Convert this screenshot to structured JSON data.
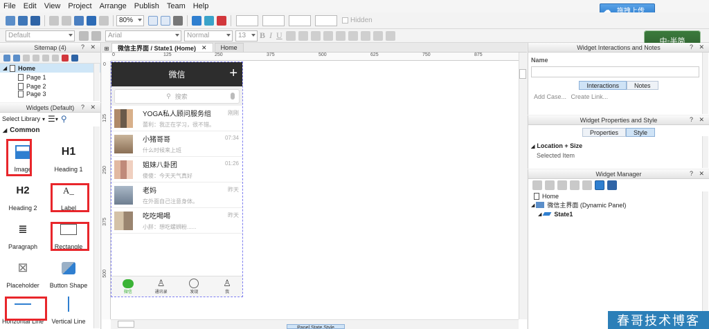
{
  "menu": [
    "File",
    "Edit",
    "View",
    "Project",
    "Arrange",
    "Publish",
    "Team",
    "Help"
  ],
  "upload_label": "拖拽上传",
  "toolbar": {
    "zoom": "80%",
    "hidden_label": "Hidden"
  },
  "format_bar": {
    "style": "Default",
    "font": "Arial",
    "weight": "Normal",
    "size": "13"
  },
  "logo_text": "中◦半简",
  "sitemap": {
    "title": "Sitemap (4)",
    "root": "Home",
    "pages": [
      "Page 1",
      "Page 2",
      "Page 3"
    ]
  },
  "widgets": {
    "title": "Widgets (Default)",
    "select_library": "Select Library",
    "category": "Common",
    "items": [
      "Image",
      "Heading 1",
      "Heading 2",
      "Label",
      "Paragraph",
      "Rectangle",
      "Placeholder",
      "Button Shape",
      "Horizontal Line",
      "Vertical Line"
    ],
    "glyph_h1": "H1",
    "glyph_h2": "H2",
    "glyph_label": "A_"
  },
  "canvas": {
    "tab_active": "微信主界面 / State1 (Home)",
    "tab_other": "Home",
    "ruler_h": [
      "0",
      "125",
      "250",
      "375",
      "500",
      "625",
      "750",
      "875"
    ],
    "ruler_v": [
      "0",
      "125",
      "250",
      "375",
      "500"
    ],
    "panel_state_style": "Panel State Style"
  },
  "phone": {
    "title": "微信",
    "plus": "+",
    "search": "搜索",
    "chats": [
      {
        "name": "YOGA私人顾问服务组",
        "msg": "蕾利：我正在学习，很不错。",
        "time": "刚刚"
      },
      {
        "name": "小猪哥哥",
        "msg": "什么时候来上班",
        "time": "07:34"
      },
      {
        "name": "姐妹八卦团",
        "msg": "傻傻：今天天气真好",
        "time": "01:26"
      },
      {
        "name": "老妈",
        "msg": "在外面自己注意身体。",
        "time": "昨天"
      },
      {
        "name": "吃吃喝喝",
        "msg": "小胖：想吃螺蛳粉......",
        "time": "昨天"
      }
    ],
    "nav": [
      "微信",
      "通讯录",
      "发现",
      "我"
    ]
  },
  "interactions": {
    "title": "Widget Interactions and Notes",
    "name_label": "Name",
    "tab_interactions": "Interactions",
    "tab_notes": "Notes",
    "add_case": "Add Case...",
    "create_link": "Create Link..."
  },
  "props": {
    "title": "Widget Properties and Style",
    "tab_properties": "Properties",
    "tab_style": "Style",
    "section": "Location + Size",
    "selected": "Selected Item"
  },
  "manager": {
    "title": "Widget Manager",
    "home": "Home",
    "panel": "微信主界面 (Dynamic Panel)",
    "state": "State1"
  },
  "pane_controls": "? ✕",
  "watermark": "春哥技术博客",
  "colors": {
    "accent_highlight": "#e8262b",
    "wechat_green": "#3bb336",
    "header_dark": "#2d2d2d"
  }
}
